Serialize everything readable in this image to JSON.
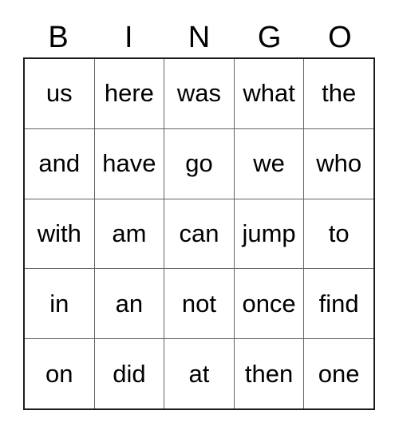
{
  "card": {
    "title": "BINGO",
    "header_letters": [
      "B",
      "I",
      "N",
      "G",
      "O"
    ],
    "colors": {
      "background": "#ffffff",
      "text": "#000000",
      "outer_border": "#1c1c1c",
      "inner_border": "#636363"
    },
    "grid": {
      "rows": 5,
      "columns": 5,
      "cells": [
        [
          {
            "word": "us"
          },
          {
            "word": "here"
          },
          {
            "word": "was"
          },
          {
            "word": "what"
          },
          {
            "word": "the"
          }
        ],
        [
          {
            "word": "and"
          },
          {
            "word": "have"
          },
          {
            "word": "go"
          },
          {
            "word": "we"
          },
          {
            "word": "who"
          }
        ],
        [
          {
            "word": "with"
          },
          {
            "word": "am"
          },
          {
            "word": "can"
          },
          {
            "word": "jump"
          },
          {
            "word": "to"
          }
        ],
        [
          {
            "word": "in"
          },
          {
            "word": "an"
          },
          {
            "word": "not"
          },
          {
            "word": "once"
          },
          {
            "word": "find"
          }
        ],
        [
          {
            "word": "on"
          },
          {
            "word": "did"
          },
          {
            "word": "at"
          },
          {
            "word": "then"
          },
          {
            "word": "one"
          }
        ]
      ]
    }
  }
}
